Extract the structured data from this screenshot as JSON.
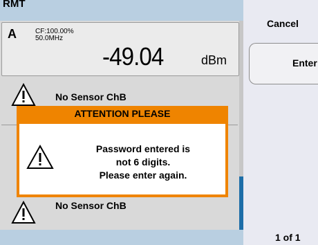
{
  "status": {
    "mode": "RMT"
  },
  "channel_a": {
    "letter": "A",
    "cf": "CF:100.00%",
    "frequency": "50.0MHz",
    "reading": "-49.04",
    "unit": "dBm"
  },
  "rows": [
    {
      "label": "No Sensor ChB"
    },
    {
      "label": "No Sensor ChB"
    }
  ],
  "softkeys": {
    "cancel": "Cancel",
    "enter": "Enter"
  },
  "pager": "1 of 1",
  "dialog": {
    "title": "ATTENTION PLEASE",
    "lines": [
      "Password entered is",
      "not 6 digits.",
      "Please enter again."
    ]
  },
  "colors": {
    "accent": "#ef8400",
    "statusbar": "#b9cfe1",
    "scroll": "#1d6ea8"
  },
  "icons": {
    "warning": "warning-triangle-icon"
  }
}
